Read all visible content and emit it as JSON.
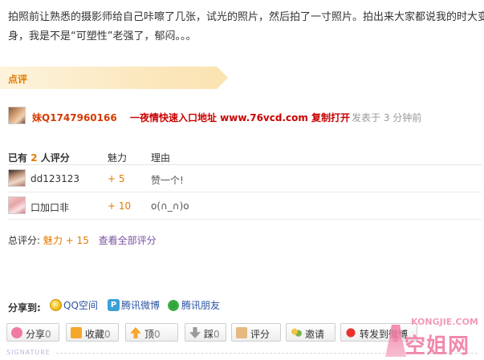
{
  "post": {
    "text": "拍照前让熟悉的摄影师给自己咔嚓了几张，试光的照片，然后拍了一寸照片。拍出来大家都说我的时大变身，我是不是“可塑性”老强了，郁闷。。。"
  },
  "review_section": {
    "label": "点评"
  },
  "comment": {
    "user": "妹Q1747960166",
    "ad_text": "一夜情快速入口地址 www.76vcd.com 复制打开",
    "meta": "发表于 3 分钟前"
  },
  "ratings": {
    "header": {
      "prefix": "已有",
      "count": "2",
      "suffix": "人评分",
      "col_charm": "魅力",
      "col_reason": "理由"
    },
    "rows": [
      {
        "user": "dd123123",
        "score": "+ 5",
        "reason": "赞一个!"
      },
      {
        "user": "口加口非",
        "score": "+ 10",
        "reason": "o(∩_∩)o"
      }
    ],
    "total_label": "总评分:",
    "total_value": "魅力 + 15",
    "view_all": "查看全部评分"
  },
  "share": {
    "label": "分享到:",
    "items": [
      {
        "label": "QQ空间",
        "icon": "qzone-icon"
      },
      {
        "label": "腾讯微博",
        "icon": "tencent-weibo-icon"
      },
      {
        "label": "腾讯朋友",
        "icon": "pengyou-icon"
      }
    ]
  },
  "actions": {
    "share_label": "分享",
    "share_count": "0",
    "fav_label": "收藏",
    "fav_count": "0",
    "up_label": "顶",
    "up_count": "0",
    "down_label": "踩",
    "down_count": "0",
    "rate_label": "评分",
    "invite_label": "邀请",
    "weibo_label": "转发到微博"
  },
  "signature": "SIGNATURE",
  "watermark": {
    "url": "KONGJIE.COM",
    "logo": "空姐网"
  }
}
